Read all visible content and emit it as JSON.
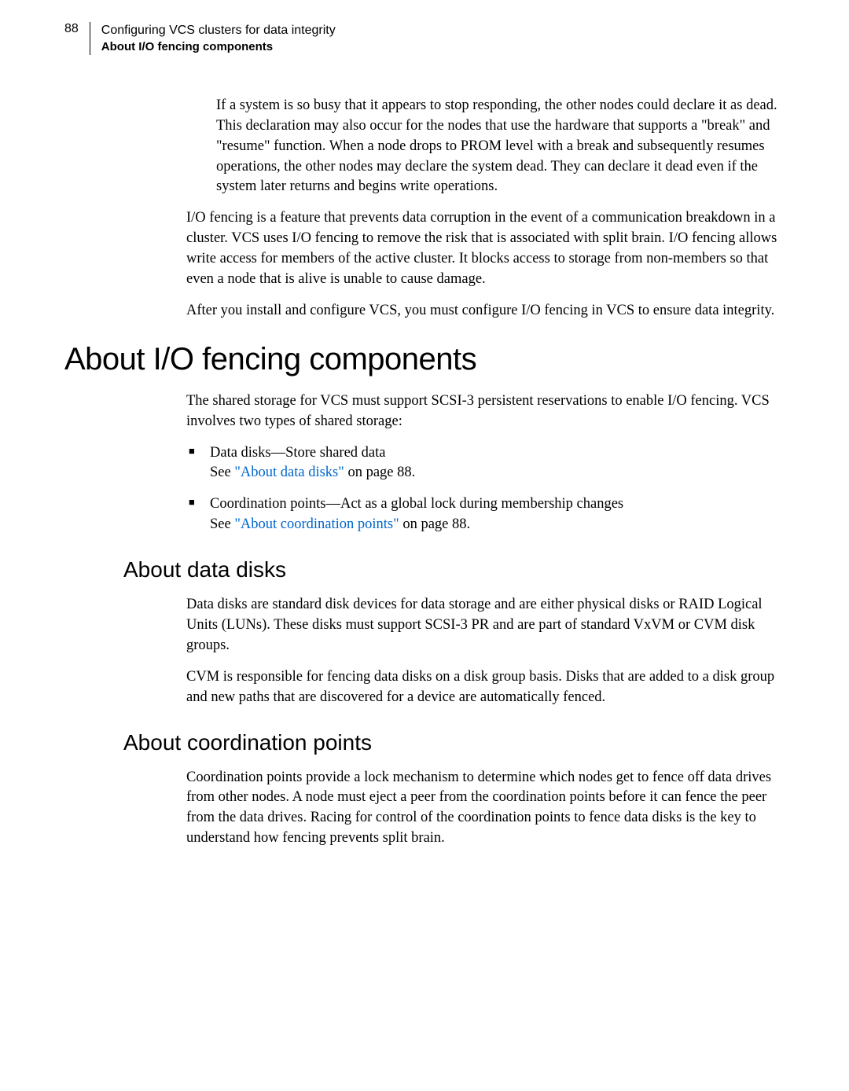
{
  "header": {
    "page_number": "88",
    "line1": "Configuring VCS clusters for data integrity",
    "line2": "About I/O fencing components"
  },
  "intro_para": "If a system is so busy that it appears to stop responding, the other nodes could declare it as dead. This declaration may also occur for the nodes that use the hardware that supports a \"break\" and \"resume\" function. When a node drops to PROM level with a break and subsequently resumes operations, the other nodes may declare the system dead. They can declare it dead even if the system later returns and begins write operations.",
  "para2": "I/O fencing is a feature that prevents data corruption in the event of a communication breakdown in a cluster. VCS uses I/O fencing to remove the risk that is associated with split brain. I/O fencing allows write access for members of the active cluster. It blocks access to storage from non-members so that even a node that is alive is unable to cause damage.",
  "para3": "After you install and configure VCS, you must configure I/O fencing in VCS to ensure data integrity.",
  "h1": "About I/O fencing components",
  "section1_para": "The shared storage for VCS must support SCSI-3 persistent reservations to enable I/O fencing. VCS involves two types of shared storage:",
  "bullets": [
    {
      "line1": "Data disks—Store shared data",
      "see_prefix": "See ",
      "link": "\"About data disks\"",
      "see_suffix": " on page 88."
    },
    {
      "line1": "Coordination points—Act as a global lock during membership changes",
      "see_prefix": "See ",
      "link": "\"About coordination points\"",
      "see_suffix": " on page 88."
    }
  ],
  "h2_data": "About data disks",
  "data_para1": "Data disks are standard disk devices for data storage and are either physical disks or RAID Logical Units (LUNs). These disks must support SCSI-3 PR and are part of standard VxVM or CVM disk groups.",
  "data_para2": "CVM is responsible for fencing data disks on a disk group basis. Disks that are added to a disk group and new paths that are discovered for a device are automatically fenced.",
  "h2_coord": "About coordination points",
  "coord_para1": "Coordination points provide a lock mechanism to determine which nodes get to fence off data drives from other nodes. A node must eject a peer from the coordination points before it can fence the peer from the data drives. Racing for control of the coordination points to fence data disks is the key to understand how fencing prevents split brain."
}
